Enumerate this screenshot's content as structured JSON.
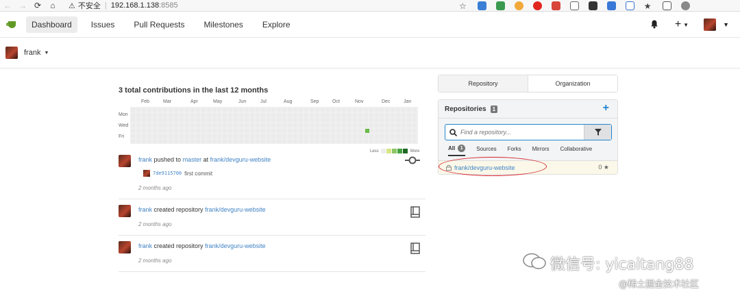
{
  "browser": {
    "security": "不安全",
    "host": "192.168.1.138",
    "port": ":8585"
  },
  "header": {
    "nav": [
      "Dashboard",
      "Issues",
      "Pull Requests",
      "Milestones",
      "Explore"
    ],
    "plus": "+"
  },
  "user": {
    "name": "frank"
  },
  "contrib": {
    "title": "3 total contributions in the last 12 months",
    "months": [
      "Feb",
      "Mar",
      "Apr",
      "May",
      "Jun",
      "Jul",
      "Aug",
      "Sep",
      "Oct",
      "Nov",
      "Dec",
      "Jan"
    ],
    "days": [
      "Mon",
      "Wed",
      "Fri"
    ],
    "legend_less": "Less",
    "legend_more": "More"
  },
  "feed": [
    {
      "user": "frank",
      "action": " pushed to ",
      "branch": "master",
      "at": " at ",
      "repo": "frank/devguru-website",
      "sha": "7de9115700",
      "message": "first commit",
      "time": "2 months ago"
    },
    {
      "user": "frank",
      "action": " created repository ",
      "repo": "frank/devguru-website",
      "time": "2 months ago"
    },
    {
      "user": "frank",
      "action": " created repository ",
      "repo": "frank/devguru-website",
      "time": "2 months ago"
    }
  ],
  "panel": {
    "tabs": [
      "Repository",
      "Organization"
    ],
    "title": "Repositories",
    "count": "1",
    "search_placeholder": "Find a repository...",
    "subtabs": [
      "All",
      "Sources",
      "Forks",
      "Mirrors",
      "Collaborative"
    ],
    "all_count": "1",
    "repo": {
      "name": "frank/devguru-website",
      "stars": "0"
    }
  },
  "watermark": {
    "line1": "微信号: yicaitang88",
    "line2": "@稀土掘金技术社区"
  },
  "colors": {
    "accent": "#4183c4",
    "brand": "#609926",
    "contrib": "#6abb49",
    "highlight": "#d4232b"
  }
}
